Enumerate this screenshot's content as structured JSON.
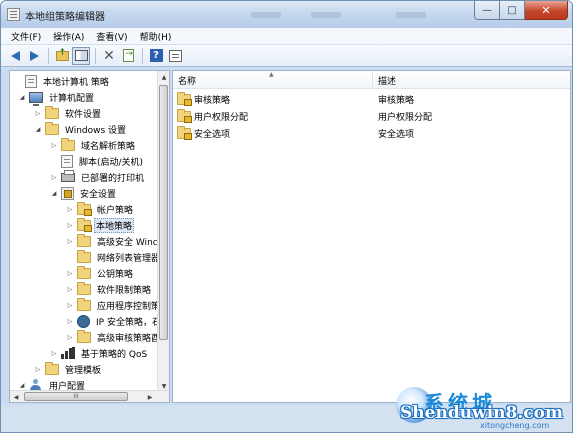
{
  "window": {
    "title": "本地组策略编辑器",
    "caption": {
      "minimize": "—",
      "maximize": "□",
      "close": "✕"
    }
  },
  "menu": [
    {
      "label": "文件(F)"
    },
    {
      "label": "操作(A)"
    },
    {
      "label": "查看(V)"
    },
    {
      "label": "帮助(H)"
    }
  ],
  "toolbar": {
    "buttons": [
      "back-arrow-icon",
      "forward-arrow-icon",
      "up-folder-icon",
      "show-hide-tree-icon",
      "delete-icon",
      "export-list-icon",
      "help-icon",
      "properties-icon"
    ]
  },
  "tree": {
    "items": [
      {
        "label": "本地计算机 策略",
        "icon": "policy-icon",
        "expander": ""
      },
      {
        "label": "计算机配置",
        "icon": "computer-icon",
        "expander": "◢"
      },
      {
        "label": "软件设置",
        "icon": "folder-icon",
        "expander": "▷"
      },
      {
        "label": "Windows 设置",
        "icon": "folder-icon",
        "expander": "◢"
      },
      {
        "label": "域名解析策略",
        "icon": "folder-icon",
        "expander": "▷"
      },
      {
        "label": "脚本(启动/关机)",
        "icon": "script-icon",
        "expander": ""
      },
      {
        "label": "已部署的打印机",
        "icon": "printer-icon",
        "expander": "▷"
      },
      {
        "label": "安全设置",
        "icon": "security-settings-icon",
        "expander": "◢"
      },
      {
        "label": "帐户策略",
        "icon": "lock-folder-icon",
        "expander": "▷"
      },
      {
        "label": "本地策略",
        "icon": "lock-folder-icon",
        "expander": "▷"
      },
      {
        "label": "高级安全 Winc",
        "icon": "folder-icon",
        "expander": "▷"
      },
      {
        "label": "网络列表管理器",
        "icon": "folder-icon",
        "expander": ""
      },
      {
        "label": "公钥策略",
        "icon": "folder-icon",
        "expander": "▷"
      },
      {
        "label": "软件限制策略",
        "icon": "folder-icon",
        "expander": "▷"
      },
      {
        "label": "应用程序控制策",
        "icon": "folder-icon",
        "expander": "▷"
      },
      {
        "label": "IP 安全策略，石",
        "icon": "ipsec-icon",
        "expander": "▷"
      },
      {
        "label": "高级审核策略酉",
        "icon": "folder-icon",
        "expander": "▷"
      },
      {
        "label": "基于策略的 QoS",
        "icon": "qos-icon",
        "expander": "▷"
      },
      {
        "label": "管理模板",
        "icon": "folder-icon",
        "expander": "▷"
      },
      {
        "label": "用户配置",
        "icon": "user-icon",
        "expander": "◢"
      }
    ],
    "selected_index": 9,
    "hscroll_grip": "III"
  },
  "list": {
    "columns": {
      "name": "名称",
      "description": "描述"
    },
    "rows": [
      {
        "name": "审核策略",
        "description": "审核策略"
      },
      {
        "name": "用户权限分配",
        "description": "用户权限分配"
      },
      {
        "name": "安全选项",
        "description": "安全选项"
      }
    ]
  },
  "watermark": {
    "title": "系统城",
    "url": "Shenduwin8.com",
    "sub": "xitongcheng.com"
  }
}
